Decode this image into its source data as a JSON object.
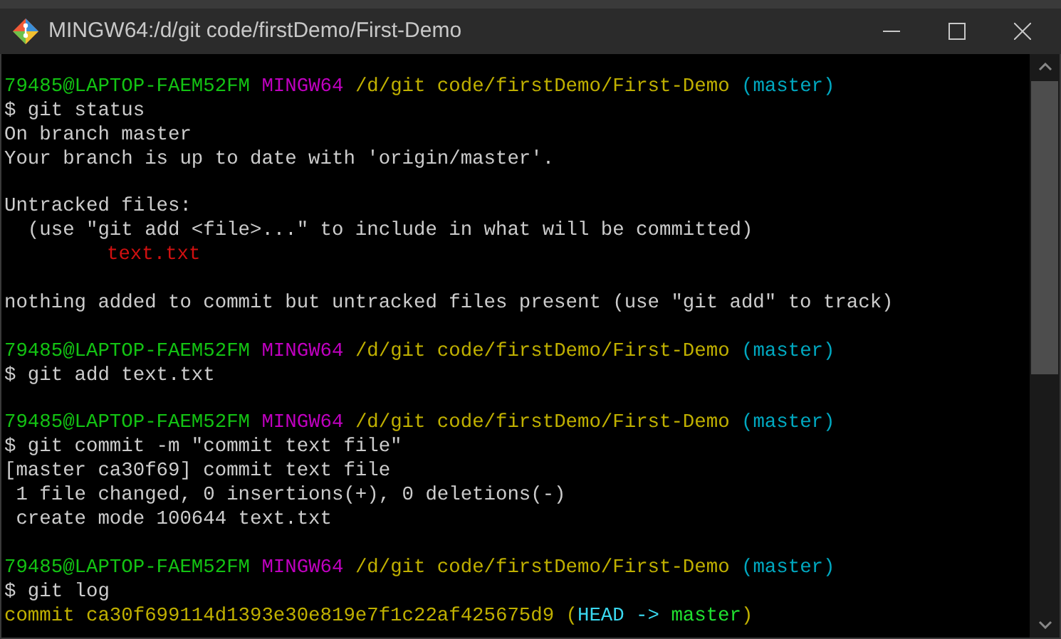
{
  "window": {
    "title": "MINGW64:/d/git code/firstDemo/First-Demo"
  },
  "terminal": {
    "lines": [
      {
        "kind": "output",
        "segments": [
          {
            "kind": "user",
            "text": "79485@LAPTOP-FAEM52FM "
          },
          {
            "kind": "system",
            "text": "MINGW64 "
          },
          {
            "kind": "path",
            "text": "/d/git code/firstDemo/First-Demo "
          },
          {
            "kind": "branch",
            "text": "(master)"
          }
        ]
      },
      {
        "kind": "output",
        "segments": [
          {
            "kind": "plain",
            "text": "$ git status"
          }
        ]
      },
      {
        "kind": "output",
        "segments": [
          {
            "kind": "plain",
            "text": "On branch master"
          }
        ]
      },
      {
        "kind": "output",
        "segments": [
          {
            "kind": "plain",
            "text": "Your branch is up to date with 'origin/master'."
          }
        ]
      },
      {
        "kind": "blank"
      },
      {
        "kind": "output",
        "segments": [
          {
            "kind": "plain",
            "text": "Untracked files:"
          }
        ]
      },
      {
        "kind": "output",
        "segments": [
          {
            "kind": "plain",
            "text": "  (use \"git add <file>...\" to include in what will be committed)"
          }
        ]
      },
      {
        "kind": "indented",
        "segments": [
          {
            "kind": "untracked",
            "text": "text.txt"
          }
        ]
      },
      {
        "kind": "blank"
      },
      {
        "kind": "output",
        "segments": [
          {
            "kind": "plain",
            "text": "nothing added to commit but untracked files present (use \"git add\" to track)"
          }
        ]
      },
      {
        "kind": "blank"
      },
      {
        "kind": "output",
        "segments": [
          {
            "kind": "user",
            "text": "79485@LAPTOP-FAEM52FM "
          },
          {
            "kind": "system",
            "text": "MINGW64 "
          },
          {
            "kind": "path",
            "text": "/d/git code/firstDemo/First-Demo "
          },
          {
            "kind": "branch",
            "text": "(master)"
          }
        ]
      },
      {
        "kind": "output",
        "segments": [
          {
            "kind": "plain",
            "text": "$ git add text.txt"
          }
        ]
      },
      {
        "kind": "blank"
      },
      {
        "kind": "output",
        "segments": [
          {
            "kind": "user",
            "text": "79485@LAPTOP-FAEM52FM "
          },
          {
            "kind": "system",
            "text": "MINGW64 "
          },
          {
            "kind": "path",
            "text": "/d/git code/firstDemo/First-Demo "
          },
          {
            "kind": "branch",
            "text": "(master)"
          }
        ]
      },
      {
        "kind": "output",
        "segments": [
          {
            "kind": "plain",
            "text": "$ git commit -m \"commit text file\""
          }
        ]
      },
      {
        "kind": "output",
        "segments": [
          {
            "kind": "plain",
            "text": "[master ca30f69] commit text file"
          }
        ]
      },
      {
        "kind": "output",
        "segments": [
          {
            "kind": "plain",
            "text": " 1 file changed, 0 insertions(+), 0 deletions(-)"
          }
        ]
      },
      {
        "kind": "output",
        "segments": [
          {
            "kind": "plain",
            "text": " create mode 100644 text.txt"
          }
        ]
      },
      {
        "kind": "blank"
      },
      {
        "kind": "output",
        "segments": [
          {
            "kind": "user",
            "text": "79485@LAPTOP-FAEM52FM "
          },
          {
            "kind": "system",
            "text": "MINGW64 "
          },
          {
            "kind": "path",
            "text": "/d/git code/firstDemo/First-Demo "
          },
          {
            "kind": "branch",
            "text": "(master)"
          }
        ]
      },
      {
        "kind": "output",
        "segments": [
          {
            "kind": "plain",
            "text": "$ git log"
          }
        ]
      },
      {
        "kind": "output",
        "segments": [
          {
            "kind": "path",
            "text": "commit ca30f699114d1393e30e819e7f1c22af425675d9 ("
          },
          {
            "kind": "head",
            "text": "HEAD -> "
          },
          {
            "kind": "ref",
            "text": "master"
          },
          {
            "kind": "path",
            "text": ")"
          }
        ]
      }
    ]
  }
}
